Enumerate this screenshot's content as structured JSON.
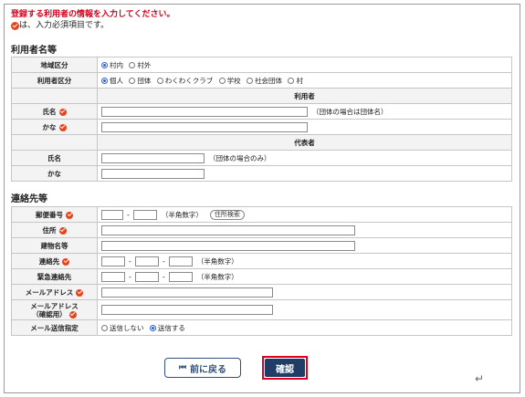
{
  "notice": {
    "title": "登録する利用者の情報を入力してください。",
    "required_note": "は、入力必須項目です。"
  },
  "section_user": {
    "title": "利用者名等",
    "area": {
      "label": "地域区分",
      "options": [
        "村内",
        "村外"
      ],
      "selected": "村内"
    },
    "user_type": {
      "label": "利用者区分",
      "options": [
        "個人",
        "団体",
        "わくわくクラブ",
        "学校",
        "社会団体",
        "村"
      ],
      "selected": "個人"
    },
    "user_band": "利用者",
    "name": {
      "label": "氏名",
      "note": "（団体の場合は団体名）"
    },
    "kana": {
      "label": "かな"
    },
    "rep_band": "代表者",
    "rep_name": {
      "label": "氏名",
      "note": "（団体の場合のみ）"
    },
    "rep_kana": {
      "label": "かな"
    }
  },
  "section_contact": {
    "title": "連絡先等",
    "postal": {
      "label": "郵便番号",
      "sep": "-",
      "note": "（半角数字）",
      "search_button": "住所検索"
    },
    "address": {
      "label": "住所"
    },
    "building": {
      "label": "建物名等"
    },
    "phone": {
      "label": "連絡先",
      "sep": "-",
      "note": "（半角数字）"
    },
    "emergency": {
      "label": "緊急連絡先",
      "sep": "-",
      "note": "（半角数字）"
    },
    "email": {
      "label": "メールアドレス"
    },
    "email_confirm": {
      "label_line1": "メールアドレス",
      "label_line2": "（確認用）"
    },
    "mail_send": {
      "label": "メール送信指定",
      "options": [
        "送信しない",
        "送信する"
      ],
      "selected": "送信する"
    }
  },
  "buttons": {
    "back": "前に戻る",
    "back_icon": "⏮",
    "confirm": "確認"
  },
  "colors": {
    "notice": "#d7001c",
    "required_mark": "#e8431c",
    "primary_button": "#1f3d67",
    "highlight_border": "#e0001b"
  }
}
